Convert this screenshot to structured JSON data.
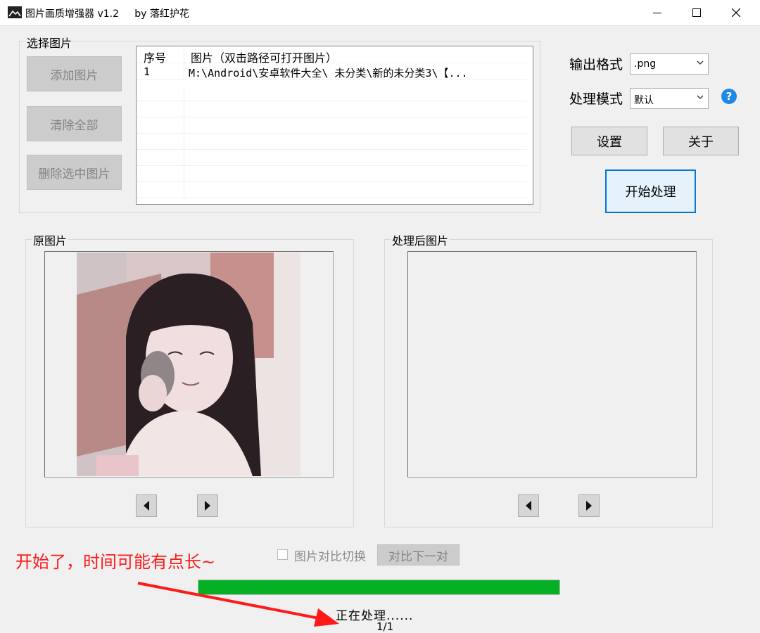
{
  "window": {
    "title": "图片画质增强器 v1.2     by 落红护花",
    "minimize_glyph": "—",
    "maximize_glyph": "☐",
    "close_glyph": "✕"
  },
  "select_group": {
    "label": "选择图片",
    "add_button": "添加图片",
    "clear_button": "清除全部",
    "delete_button": "删除选中图片"
  },
  "file_list": {
    "columns": [
      "序号",
      "图片（双击路径可打开图片）"
    ],
    "rows": [
      {
        "index": "1",
        "path": "M:\\Android\\安卓软件大全\\ 未分类\\新的未分类3\\【..."
      }
    ]
  },
  "output_format": {
    "label": "输出格式",
    "value": ".png"
  },
  "process_mode": {
    "label": "处理模式",
    "value": "默认",
    "help_glyph": "?"
  },
  "buttons": {
    "settings": "设置",
    "about": "关于",
    "start": "开始处理"
  },
  "original_group": {
    "label": "原图片"
  },
  "processed_group": {
    "label": "处理后图片"
  },
  "annotation": {
    "text": "开始了，时间可能有点长~"
  },
  "compare": {
    "checkbox_label": "图片对比切换",
    "checked": false,
    "next_button": "对比下一对"
  },
  "progress": {
    "value": 1.0,
    "status": "正在处理......",
    "count": "1/1"
  },
  "colors": {
    "progress": "#06b025",
    "annotation": "#ff1a1a",
    "accent": "#0078d7",
    "help": "#1e88e5"
  },
  "icons": [
    "app-image-icon",
    "minimize-icon",
    "maximize-icon",
    "close-icon",
    "help-icon",
    "chevron-down-icon",
    "arrow-left-icon",
    "arrow-right-icon",
    "red-arrow"
  ]
}
